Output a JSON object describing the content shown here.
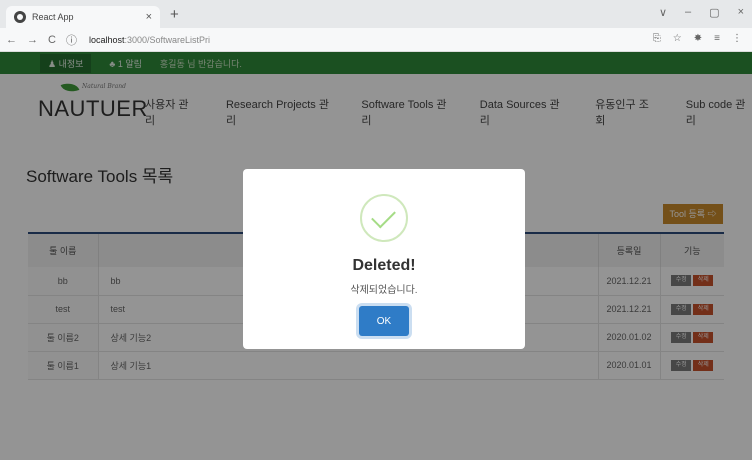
{
  "browser": {
    "tab_title": "React App",
    "tab_close": "×",
    "new_tab": "+",
    "window_controls": [
      "∨",
      "–",
      "▢",
      "×"
    ],
    "nav": {
      "back": "←",
      "forward": "→",
      "reload": "C",
      "info": "ⓘ"
    },
    "url_host": "localhost",
    "url_path": ":3000/SoftwareListPri",
    "addr_icons": [
      "⎘",
      "☆",
      "✸",
      "≡",
      "⋮"
    ]
  },
  "topbar": {
    "my_info": "♟ 내정보",
    "alarm": "♣ 1 알림",
    "welcome": "홍길동 님 반갑습니다."
  },
  "header": {
    "brand": "NAUTUER",
    "brand_sub": "Natural Brand",
    "nav": [
      "사용자 관리",
      "Research Projects 관리",
      "Software Tools 관리",
      "Data Sources 관리",
      "유동인구 조회",
      "Sub code 관리"
    ]
  },
  "page": {
    "title": "Software Tools 목록",
    "register_button": "Tool 등록 ⇨"
  },
  "table": {
    "headers": [
      "툴 이름",
      "",
      "등록일",
      "기능"
    ],
    "edit_label": "수정",
    "delete_label": "삭제",
    "rows": [
      {
        "name": "bb",
        "desc": "bb",
        "date": "2021.12.21"
      },
      {
        "name": "test",
        "desc": "test",
        "date": "2021.12.21"
      },
      {
        "name": "툴 이름2",
        "desc": "상세 기능2",
        "date": "2020.01.02"
      },
      {
        "name": "툴 이름1",
        "desc": "상세 기능1",
        "date": "2020.01.01"
      }
    ]
  },
  "dialog": {
    "icon": "success-check",
    "title": "Deleted!",
    "text": "삭제되었습니다.",
    "ok": "OK"
  },
  "colors": {
    "topbar": "#2f8a3a",
    "register_button": "#c98a2b",
    "table_border": "#2c4a7a",
    "edit_button": "#7a7a7a",
    "delete_button": "#c6522b",
    "ok_button": "#2f7cc7",
    "success_check": "#a5dc86"
  }
}
